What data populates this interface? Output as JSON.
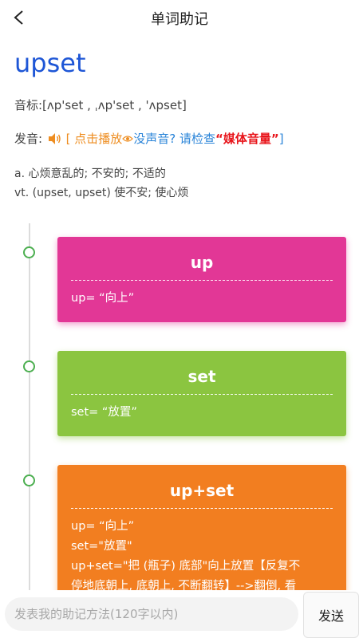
{
  "header": {
    "title": "单词助记",
    "back_icon": "chevron-left-icon"
  },
  "word": {
    "text": "upset",
    "phonetic": "音标:[ʌp'set , ˌʌp'set , 'ʌpset]",
    "pronunciation": {
      "label": "发音: ",
      "play_text": "[ 点击播放",
      "hint_text": "没声音? 请检查",
      "media_text": "“媒体音量”",
      "close_bracket": "]"
    },
    "definitions": [
      "a. 心烦意乱的; 不安的; 不适的",
      "vt. (upset, upset) 使不安; 使心烦"
    ]
  },
  "cards": [
    {
      "title": "up",
      "color": "#e23796",
      "lines": [
        "up= “向上”"
      ]
    },
    {
      "title": "set",
      "color": "#8bc540",
      "lines": [
        "set= “放置”"
      ]
    },
    {
      "title": "up+set",
      "color": "#f27e20",
      "lines": [
        "up= “向上”",
        "set=\"放置\"",
        "up+set=\"把 (瓶子) 底部\"向上放置【反复不",
        "停地底朝上, 底朝上, 不断翻转】-->翻倒, 看"
      ]
    }
  ],
  "timeline_dot_color": "#4caf50",
  "comment": {
    "placeholder": "发表我的助记方法(120字以内)",
    "send_label": "发送"
  }
}
